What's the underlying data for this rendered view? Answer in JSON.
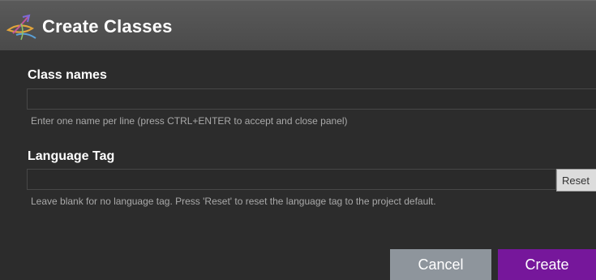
{
  "dialog": {
    "title": "Create Classes",
    "logo_icon": "vertex-logo-icon"
  },
  "class_names": {
    "label": "Class names",
    "value": "",
    "help": "Enter one name per line (press CTRL+ENTER to accept and close panel)"
  },
  "language_tag": {
    "label": "Language Tag",
    "value": "",
    "reset_label": "Reset",
    "help": "Leave blank for no language tag. Press 'Reset' to reset the language tag to the project default."
  },
  "footer": {
    "cancel_label": "Cancel",
    "create_label": "Create"
  },
  "colors": {
    "background": "#2c2c2c",
    "titlebar": "#4f4f4f",
    "create_accent": "#76179b",
    "cancel": "#8e959c"
  }
}
